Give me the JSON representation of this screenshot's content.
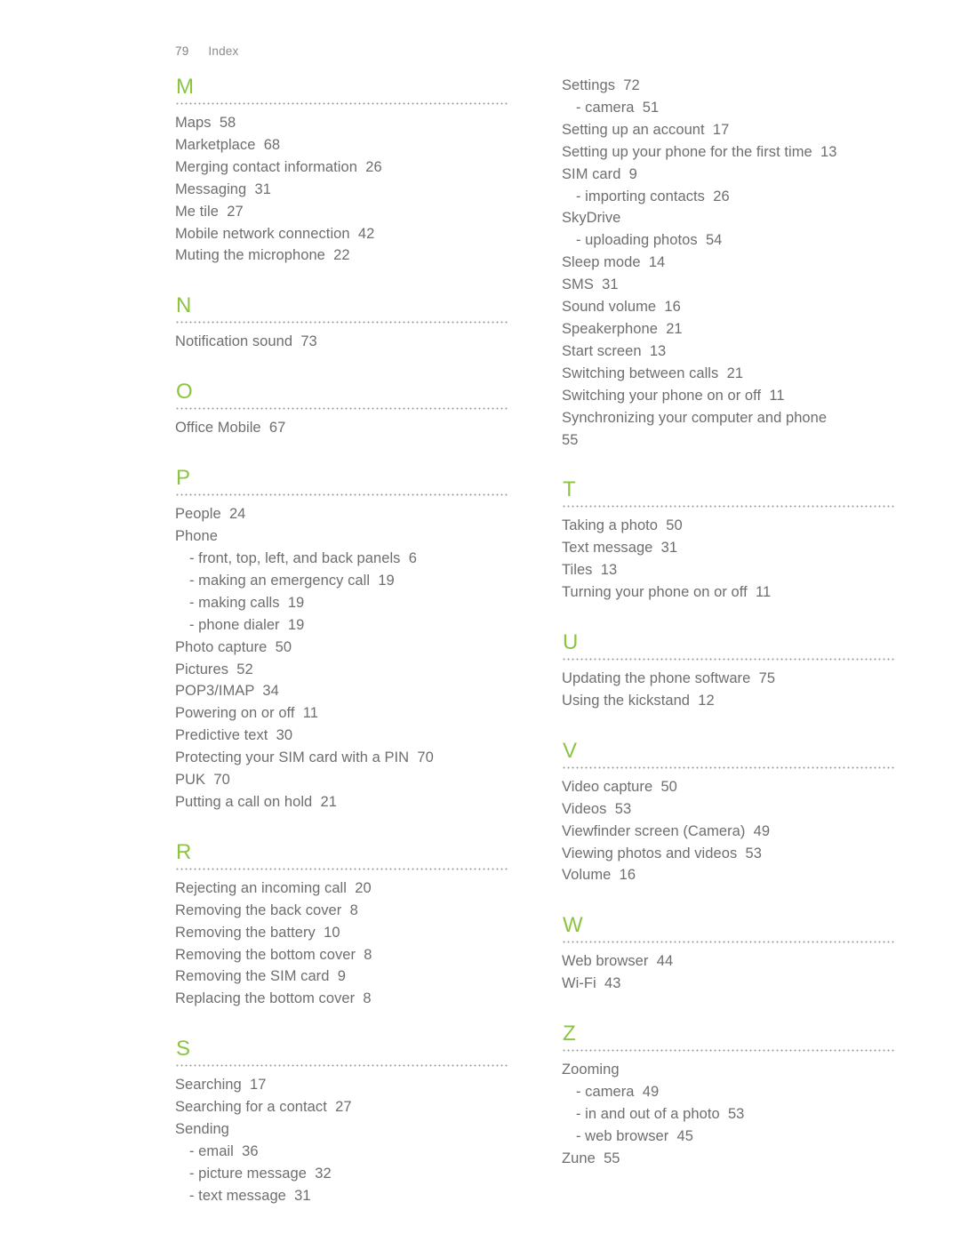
{
  "header": {
    "page_number": "79",
    "section_name": "Index"
  },
  "accent_color": "#8bc53f",
  "text_color": "#6e6e6e",
  "columns": [
    {
      "name": "left-column",
      "sections": [
        {
          "letter": "M",
          "entries": [
            {
              "text": "Maps  58",
              "sub": false
            },
            {
              "text": "Marketplace  68",
              "sub": false
            },
            {
              "text": "Merging contact information  26",
              "sub": false
            },
            {
              "text": "Messaging  31",
              "sub": false
            },
            {
              "text": "Me tile  27",
              "sub": false
            },
            {
              "text": "Mobile network connection  42",
              "sub": false
            },
            {
              "text": "Muting the microphone  22",
              "sub": false
            }
          ]
        },
        {
          "letter": "N",
          "entries": [
            {
              "text": "Notification sound  73",
              "sub": false
            }
          ]
        },
        {
          "letter": "O",
          "entries": [
            {
              "text": "Office Mobile  67",
              "sub": false
            }
          ]
        },
        {
          "letter": "P",
          "entries": [
            {
              "text": "People  24",
              "sub": false
            },
            {
              "text": "Phone",
              "sub": false
            },
            {
              "text": "- front, top, left, and back panels  6",
              "sub": true
            },
            {
              "text": "- making an emergency call  19",
              "sub": true
            },
            {
              "text": "- making calls  19",
              "sub": true
            },
            {
              "text": "- phone dialer  19",
              "sub": true
            },
            {
              "text": "Photo capture  50",
              "sub": false
            },
            {
              "text": "Pictures  52",
              "sub": false
            },
            {
              "text": "POP3/IMAP  34",
              "sub": false
            },
            {
              "text": "Powering on or off  11",
              "sub": false
            },
            {
              "text": "Predictive text  30",
              "sub": false
            },
            {
              "text": "Protecting your SIM card with a PIN  70",
              "sub": false
            },
            {
              "text": "PUK  70",
              "sub": false
            },
            {
              "text": "Putting a call on hold  21",
              "sub": false
            }
          ]
        },
        {
          "letter": "R",
          "entries": [
            {
              "text": "Rejecting an incoming call  20",
              "sub": false
            },
            {
              "text": "Removing the back cover  8",
              "sub": false
            },
            {
              "text": "Removing the battery  10",
              "sub": false
            },
            {
              "text": "Removing the bottom cover  8",
              "sub": false
            },
            {
              "text": "Removing the SIM card  9",
              "sub": false
            },
            {
              "text": "Replacing the bottom cover  8",
              "sub": false
            }
          ]
        },
        {
          "letter": "S",
          "entries": [
            {
              "text": "Searching  17",
              "sub": false
            },
            {
              "text": "Searching for a contact  27",
              "sub": false
            },
            {
              "text": "Sending",
              "sub": false
            },
            {
              "text": "- email  36",
              "sub": true
            },
            {
              "text": "- picture message  32",
              "sub": true
            },
            {
              "text": "- text message  31",
              "sub": true
            }
          ]
        }
      ]
    },
    {
      "name": "right-column",
      "sections": [
        {
          "letter": "",
          "entries": [
            {
              "text": "Settings  72",
              "sub": false
            },
            {
              "text": "- camera  51",
              "sub": true
            },
            {
              "text": "Setting up an account  17",
              "sub": false
            },
            {
              "text": "Setting up your phone for the first time  13",
              "sub": false
            },
            {
              "text": "SIM card  9",
              "sub": false
            },
            {
              "text": "- importing contacts  26",
              "sub": true
            },
            {
              "text": "SkyDrive",
              "sub": false
            },
            {
              "text": "- uploading photos  54",
              "sub": true
            },
            {
              "text": "Sleep mode  14",
              "sub": false
            },
            {
              "text": "SMS  31",
              "sub": false
            },
            {
              "text": "Sound volume  16",
              "sub": false
            },
            {
              "text": "Speakerphone  21",
              "sub": false
            },
            {
              "text": "Start screen  13",
              "sub": false
            },
            {
              "text": "Switching between calls  21",
              "sub": false
            },
            {
              "text": "Switching your phone on or off  11",
              "sub": false
            },
            {
              "text": "Synchronizing your computer and phone",
              "sub": false
            },
            {
              "text": "55",
              "sub": false
            }
          ]
        },
        {
          "letter": "T",
          "entries": [
            {
              "text": "Taking a photo  50",
              "sub": false
            },
            {
              "text": "Text message  31",
              "sub": false
            },
            {
              "text": "Tiles  13",
              "sub": false
            },
            {
              "text": "Turning your phone on or off  11",
              "sub": false
            }
          ]
        },
        {
          "letter": "U",
          "entries": [
            {
              "text": "Updating the phone software  75",
              "sub": false
            },
            {
              "text": "Using the kickstand  12",
              "sub": false
            }
          ]
        },
        {
          "letter": "V",
          "entries": [
            {
              "text": "Video capture  50",
              "sub": false
            },
            {
              "text": "Videos  53",
              "sub": false
            },
            {
              "text": "Viewfinder screen (Camera)  49",
              "sub": false
            },
            {
              "text": "Viewing photos and videos  53",
              "sub": false
            },
            {
              "text": "Volume  16",
              "sub": false
            }
          ]
        },
        {
          "letter": "W",
          "entries": [
            {
              "text": "Web browser  44",
              "sub": false
            },
            {
              "text": "Wi-Fi  43",
              "sub": false
            }
          ]
        },
        {
          "letter": "Z",
          "entries": [
            {
              "text": "Zooming",
              "sub": false
            },
            {
              "text": "- camera  49",
              "sub": true
            },
            {
              "text": "- in and out of a photo  53",
              "sub": true
            },
            {
              "text": "- web browser  45",
              "sub": true
            },
            {
              "text": "Zune  55",
              "sub": false
            }
          ]
        }
      ]
    }
  ]
}
